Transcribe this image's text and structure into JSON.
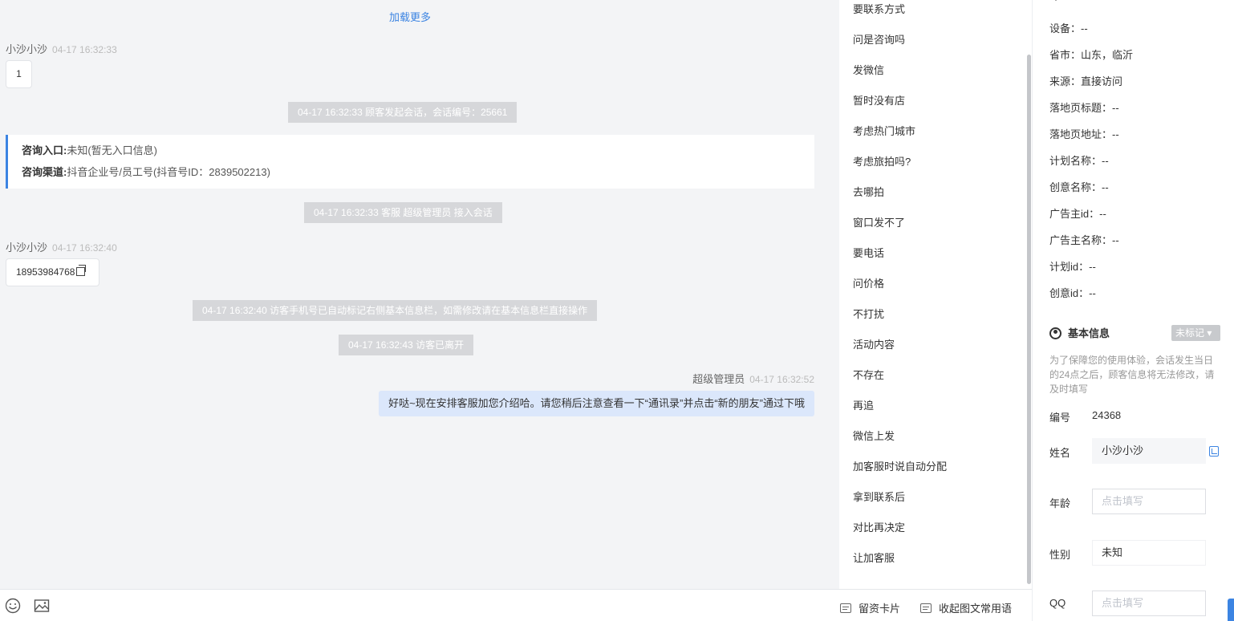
{
  "chat": {
    "load_more": "加载更多",
    "msg1": {
      "sender": "小沙小沙",
      "time": "04-17 16:32:33",
      "text": "1"
    },
    "sys1": "04-17 16:32:33 顾客发起会话，会话编号：25661",
    "entry": {
      "entry_key": "咨询入口:",
      "entry_value": "未知(暂无入口信息)",
      "channel_key": "咨询渠道:",
      "channel_value": "抖音企业号/员工号(抖音号ID：2839502213)"
    },
    "sys2": "04-17 16:32:33 客服 超级管理员 接入会话",
    "msg2": {
      "sender": "小沙小沙",
      "time": "04-17 16:32:40",
      "text": "18953984768"
    },
    "sys3": "04-17 16:32:40 访客手机号已自动标记右侧基本信息栏，如需修改请在基本信息栏直接操作",
    "sys4": "04-17 16:32:43 访客已离开",
    "agent_msg": {
      "sender": "超级管理员",
      "time": "04-17 16:32:52",
      "text": "好哒~现在安排客服加您介绍哈。请您稍后注意查看一下“通讯录”并点击“新的朋友”通过下哦"
    }
  },
  "toolbar": {
    "emoji_icon": "emoji-icon",
    "image_icon": "image-icon",
    "card_label": "留资卡片",
    "collapse_label": "收起图文常用语"
  },
  "quick_replies": [
    "要联系方式",
    "问是咨询吗",
    "发微信",
    "暂时没有店",
    "考虑热门城市",
    "考虑旅拍吗?",
    "去哪拍",
    "窗口发不了",
    "要电话",
    "问价格",
    "不打扰",
    "活动内容",
    "不存在",
    "再追",
    "微信上发",
    "加客服时说自动分配",
    "拿到联系后",
    "对比再决定",
    "让加客服"
  ],
  "visit_info": [
    "设备：--",
    "省市：山东，临沂",
    "来源：直接访问",
    "落地页标题：--",
    "落地页地址：--",
    "计划名称：--",
    "创意名称：--",
    "广告主id：--",
    "广告主名称：--",
    "计划id：--",
    "创意id：--"
  ],
  "basic_info": {
    "title": "基本信息",
    "tag": "未标记",
    "notice": "为了保障您的使用体验，会话发生当日的24点之后，顾客信息将无法修改，请及时填写",
    "id_label": "编号",
    "id_value": "24368",
    "name_label": "姓名",
    "name_value": "小沙小沙",
    "age_label": "年龄",
    "age_placeholder": "点击填写",
    "gender_label": "性别",
    "gender_value": "未知",
    "qq_label": "QQ",
    "qq_placeholder": "点击填写"
  },
  "colors": {
    "accent": "#3c84e2",
    "agent_bubble": "#dbe7fb",
    "system_bar": "#d6d7da"
  }
}
